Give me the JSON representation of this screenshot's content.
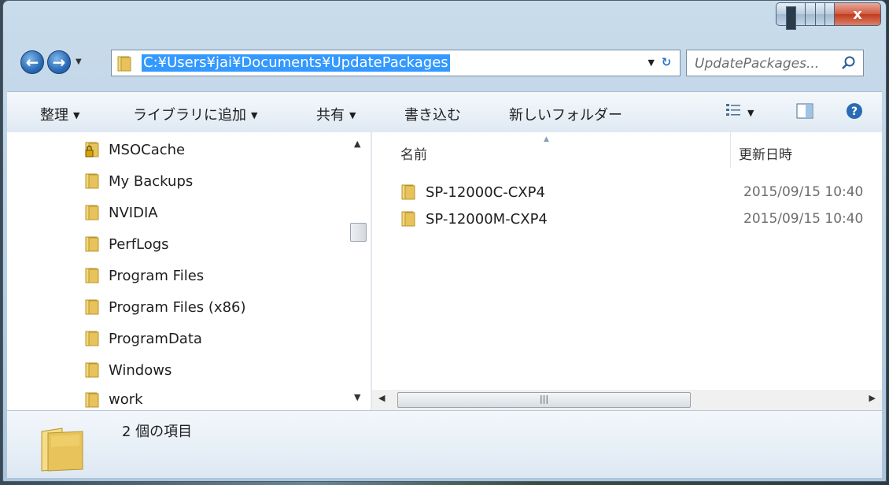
{
  "window": {
    "close_glyph": "x"
  },
  "address_bar": {
    "path": "C:¥Users¥jai¥Documents¥UpdatePackages"
  },
  "search": {
    "placeholder": "UpdatePackages..."
  },
  "toolbar": {
    "organize": "整理",
    "add_to_library": "ライブラリに追加",
    "share": "共有",
    "burn": "書き込む",
    "new_folder": "新しいフォルダー"
  },
  "nav_pane": {
    "items": [
      {
        "label": "MSOCache",
        "icon": "locked-folder-icon"
      },
      {
        "label": "My Backups",
        "icon": "folder-icon"
      },
      {
        "label": "NVIDIA",
        "icon": "folder-icon"
      },
      {
        "label": "PerfLogs",
        "icon": "folder-icon"
      },
      {
        "label": "Program Files",
        "icon": "folder-icon"
      },
      {
        "label": "Program Files (x86)",
        "icon": "folder-icon"
      },
      {
        "label": "ProgramData",
        "icon": "folder-icon"
      },
      {
        "label": "Windows",
        "icon": "folder-icon"
      },
      {
        "label": "work",
        "icon": "folder-icon"
      }
    ]
  },
  "file_list": {
    "columns": {
      "name": "名前",
      "date_modified": "更新日時"
    },
    "rows": [
      {
        "name": "SP-12000C-CXP4",
        "date": "2015/09/15 10:40"
      },
      {
        "name": "SP-12000M-CXP4",
        "date": "2015/09/15 10:40"
      }
    ]
  },
  "details": {
    "item_count": "2 個の項目"
  },
  "colors": {
    "selection": "#3399ff",
    "folder": "#e8c25a",
    "window_frame": "#b7cfe3"
  }
}
